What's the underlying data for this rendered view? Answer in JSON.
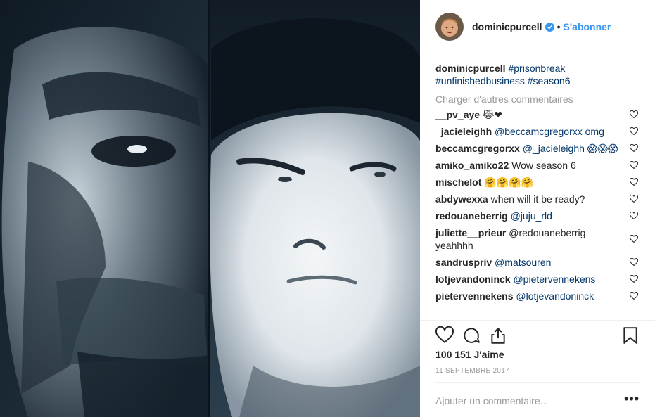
{
  "post": {
    "image_alt": "Split black and white portrait of two men",
    "colors": {
      "accent": "#3897f0",
      "hashtag": "#003569",
      "muted": "#999999",
      "divider": "#efefef"
    }
  },
  "header": {
    "username": "dominicpurcell",
    "verified_icon": "verified-badge-icon",
    "separator": "•",
    "follow_label": "S'abonner"
  },
  "caption": {
    "username": "dominicpurcell",
    "hashtags": [
      "#prisonbreak",
      "#unfinishedbusiness",
      "#season6"
    ]
  },
  "load_more_label": "Charger d'autres commentaires",
  "comments": [
    {
      "user": "__pv_aye",
      "text": "😹❤"
    },
    {
      "user": "_jacieleighh",
      "text": "@beccamcgregorxx omg"
    },
    {
      "user": "beccamcgregorxx",
      "text": "@_jacieleighh 😱😱😱"
    },
    {
      "user": "amiko_amiko22",
      "text": "Wow season 6"
    },
    {
      "user": "mischelot",
      "text": "🤗🤗🤗🤗"
    },
    {
      "user": "abdywexxa",
      "text": "when will it be ready?"
    },
    {
      "user": "redouaneberrig",
      "text": "@juju_rld"
    },
    {
      "user": "juliette__prieur",
      "text": "@redouaneberrig yeahhhh"
    },
    {
      "user": "sandruspriv",
      "text": "@matsouren"
    },
    {
      "user": "lotjevandoninck",
      "text": "@pietervennekens"
    },
    {
      "user": "pietervennekens",
      "text": "@lotjevandoninck"
    }
  ],
  "actions": {
    "like_icon": "heart-icon",
    "comment_icon": "comment-icon",
    "share_icon": "share-icon",
    "save_icon": "bookmark-icon"
  },
  "likes_label": "100 151 J'aime",
  "date_label": "11 SEPTEMBRE 2017",
  "add_comment": {
    "placeholder": "Ajouter un commentaire...",
    "options_label": "•••"
  }
}
